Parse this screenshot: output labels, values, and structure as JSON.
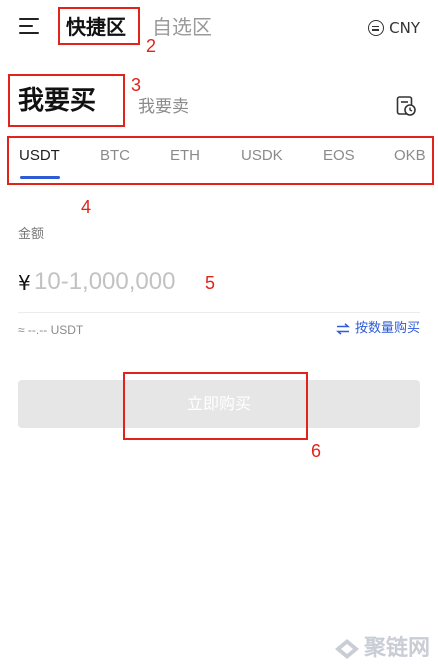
{
  "header": {
    "tab_quick": "快捷区",
    "tab_custom": "自选区",
    "currency": "CNY"
  },
  "trade": {
    "buy_title": "我要买",
    "sell_title": "我要卖"
  },
  "coins": [
    "USDT",
    "BTC",
    "ETH",
    "USDK",
    "EOS",
    "OKB"
  ],
  "active_coin": "USDT",
  "amount": {
    "label": "金额",
    "currency_symbol": "¥",
    "value": "",
    "placeholder": "10-1,000,000",
    "estimate": "≈ --.-- USDT",
    "by_quantity": "按数量购买"
  },
  "buy_button": "立即购买",
  "annotations": [
    "2",
    "3",
    "4",
    "5",
    "6"
  ],
  "watermark": "聚链网",
  "colors": {
    "accent": "#2e5bd6",
    "annotation": "#e0241b",
    "disabled_button": "#e6e6e6"
  }
}
